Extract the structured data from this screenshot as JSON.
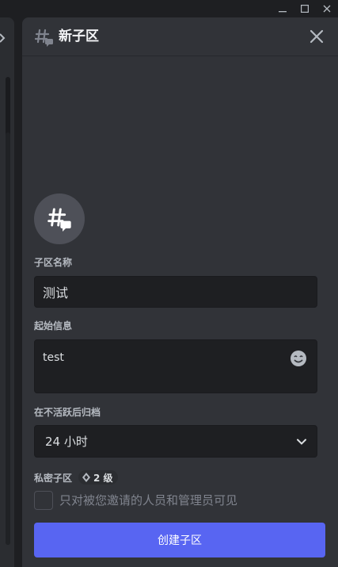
{
  "window": {
    "minimize_icon": "minimize-icon",
    "maximize_icon": "maximize-icon",
    "close_icon": "close-icon"
  },
  "thread": {
    "header_title": "新子区",
    "name_label": "子区名称",
    "name_value": "测试",
    "message_label": "起始信息",
    "message_value": "test",
    "archive_label": "在不活跃后归档",
    "archive_value": "24 小时",
    "private_label": "私密子区",
    "private_badge": "2 级",
    "private_checkbox_text": "只对被您邀请的人员和管理员可见",
    "create_button": "创建子区"
  },
  "colors": {
    "accent": "#5865f2",
    "panel_bg": "#313338",
    "input_bg": "#1e1f22"
  }
}
